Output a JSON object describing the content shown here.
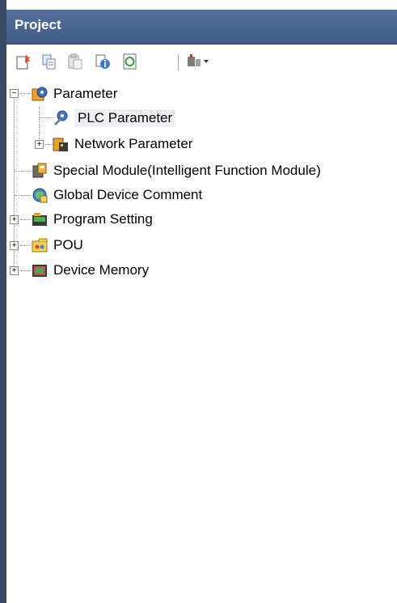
{
  "panel": {
    "title": "Project"
  },
  "toolbar": {
    "buttons": [
      {
        "name": "new-data-icon"
      },
      {
        "name": "copy-icon"
      },
      {
        "name": "paste-icon"
      },
      {
        "name": "properties-icon"
      },
      {
        "name": "refresh-icon"
      },
      {
        "name": "tools-dropdown-icon"
      }
    ]
  },
  "tree": {
    "parameter": "Parameter",
    "plc_parameter": "PLC Parameter",
    "network_parameter": "Network Parameter",
    "special_module": "Special Module(Intelligent Function Module)",
    "global_device_comment": "Global Device Comment",
    "program_setting": "Program Setting",
    "pou": "POU",
    "device_memory": "Device Memory",
    "expand_symbol": "+",
    "collapse_symbol": "−"
  }
}
